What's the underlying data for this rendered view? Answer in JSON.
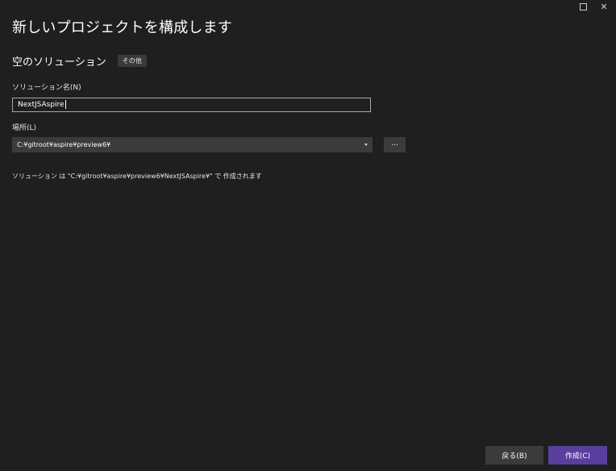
{
  "window": {
    "controls": {
      "maximize_icon": "maximize-icon",
      "close_icon": "close-icon",
      "close_glyph": "✕"
    }
  },
  "header": {
    "title": "新しいプロジェクトを構成します"
  },
  "template": {
    "name": "空のソリューション",
    "tag": "その他"
  },
  "form": {
    "solution_name": {
      "label": "ソリューション名(N)",
      "value": "NextJSAspire"
    },
    "location": {
      "label": "場所(L)",
      "value": "C:¥gitroot¥aspire¥preview6¥",
      "browse_label": "..."
    }
  },
  "info": {
    "text": "ソリューション は \"C:¥gitroot¥aspire¥preview6¥NextJSAspire¥\" で 作成されます"
  },
  "footer": {
    "back_label": "戻る(B)",
    "create_label": "作成(C)"
  },
  "colors": {
    "background": "#1f1f1f",
    "control": "#3b3b3b",
    "accent": "#5a3e9e"
  }
}
